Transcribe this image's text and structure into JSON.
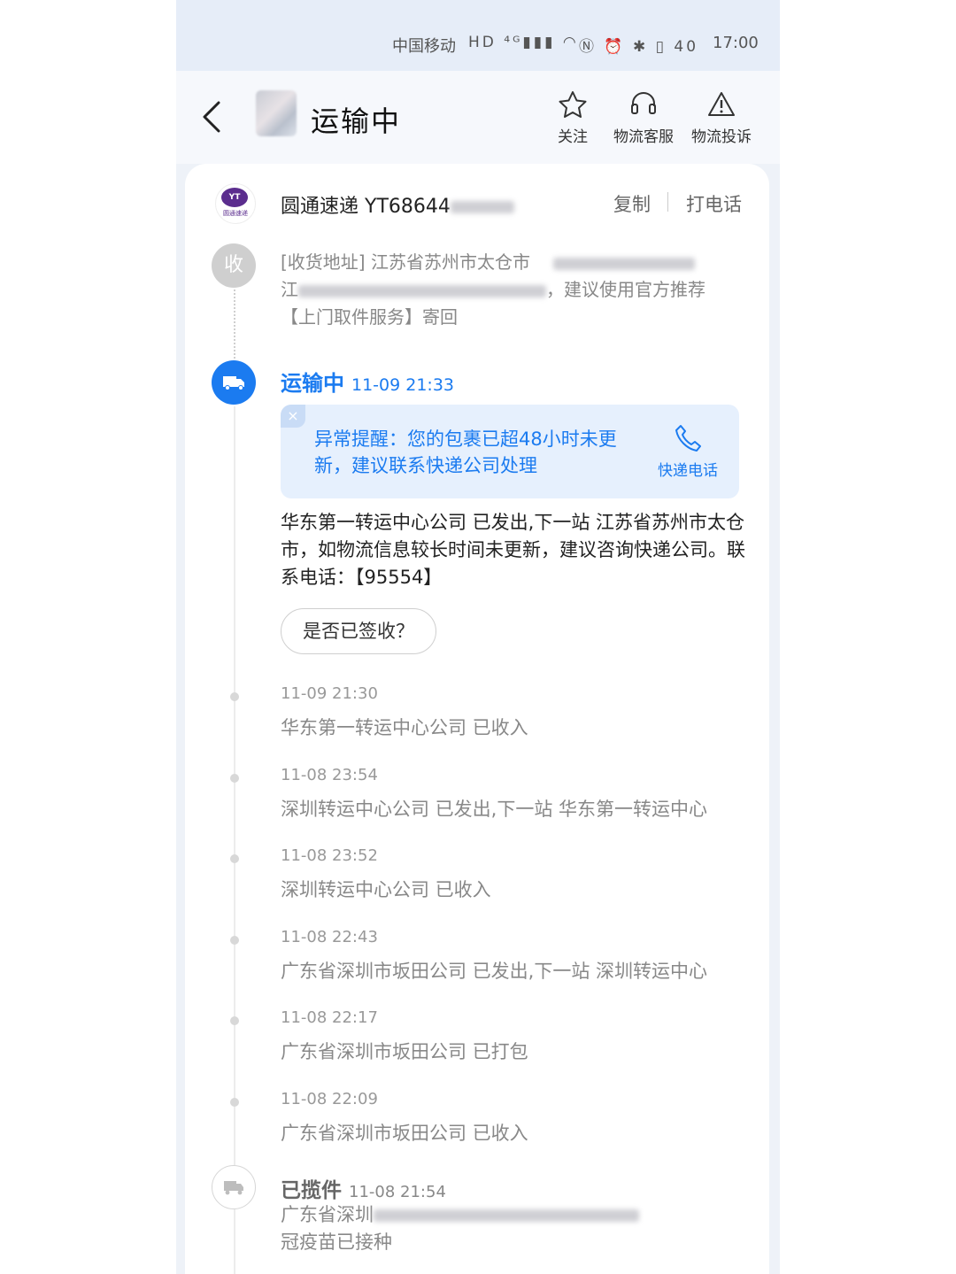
{
  "status_bar": {
    "carrier": "中国移动",
    "icons": "HD ⁴ᴳ▮▮▮ ◠",
    "right_icons": "Ⓝ ⏰ ✱ ▯ 40",
    "time": "17:00"
  },
  "header": {
    "title": "运输中",
    "actions": [
      {
        "label": "关注",
        "icon": "star-icon"
      },
      {
        "label": "物流客服",
        "icon": "headset-icon"
      },
      {
        "label": "物流投诉",
        "icon": "warning-icon"
      }
    ]
  },
  "courier": {
    "name": "圆通速递",
    "tracking_visible": "YT68644",
    "copy_label": "复制",
    "call_label": "打电话",
    "logo_text": "YT",
    "logo_sub": "圆通速递"
  },
  "receiver": {
    "badge": "收",
    "address_line1": "[收货地址] 江苏省苏州市太仓市",
    "address_line2": "江",
    "address_line2_tail": "，建议使用官方推荐",
    "address_line3": "【上门取件服务】寄回"
  },
  "transit": {
    "status": "运输中",
    "time": "11-09 21:33",
    "alert": {
      "close": "×",
      "text": "异常提醒：您的包裹已超48小时未更新，建议联系快递公司处理",
      "phone_label": "快递电话"
    },
    "detail": "华东第一转运中心公司 已发出,下一站 江苏省苏州市太仓市，如物流信息较长时间未更新，建议咨询快递公司。联系电话：【95554】",
    "signed_button": "是否已签收？"
  },
  "events": [
    {
      "time": "11-09 21:30",
      "desc": "华东第一转运中心公司 已收入"
    },
    {
      "time": "11-08 23:54",
      "desc": "深圳转运中心公司 已发出,下一站 华东第一转运中心"
    },
    {
      "time": "11-08 23:52",
      "desc": "深圳转运中心公司 已收入"
    },
    {
      "time": "11-08 22:43",
      "desc": "广东省深圳市坂田公司 已发出,下一站 深圳转运中心"
    },
    {
      "time": "11-08 22:17",
      "desc": "广东省深圳市坂田公司 已打包"
    },
    {
      "time": "11-08 22:09",
      "desc": "广东省深圳市坂田公司 已收入"
    }
  ],
  "picked": {
    "status": "已揽件",
    "time": "11-08 21:54",
    "desc_start": "广东省深圳",
    "desc_line2": "冠疫苗已接种"
  },
  "colors": {
    "accent": "#1b7bf0",
    "alert_bg": "#e6f0fd"
  }
}
